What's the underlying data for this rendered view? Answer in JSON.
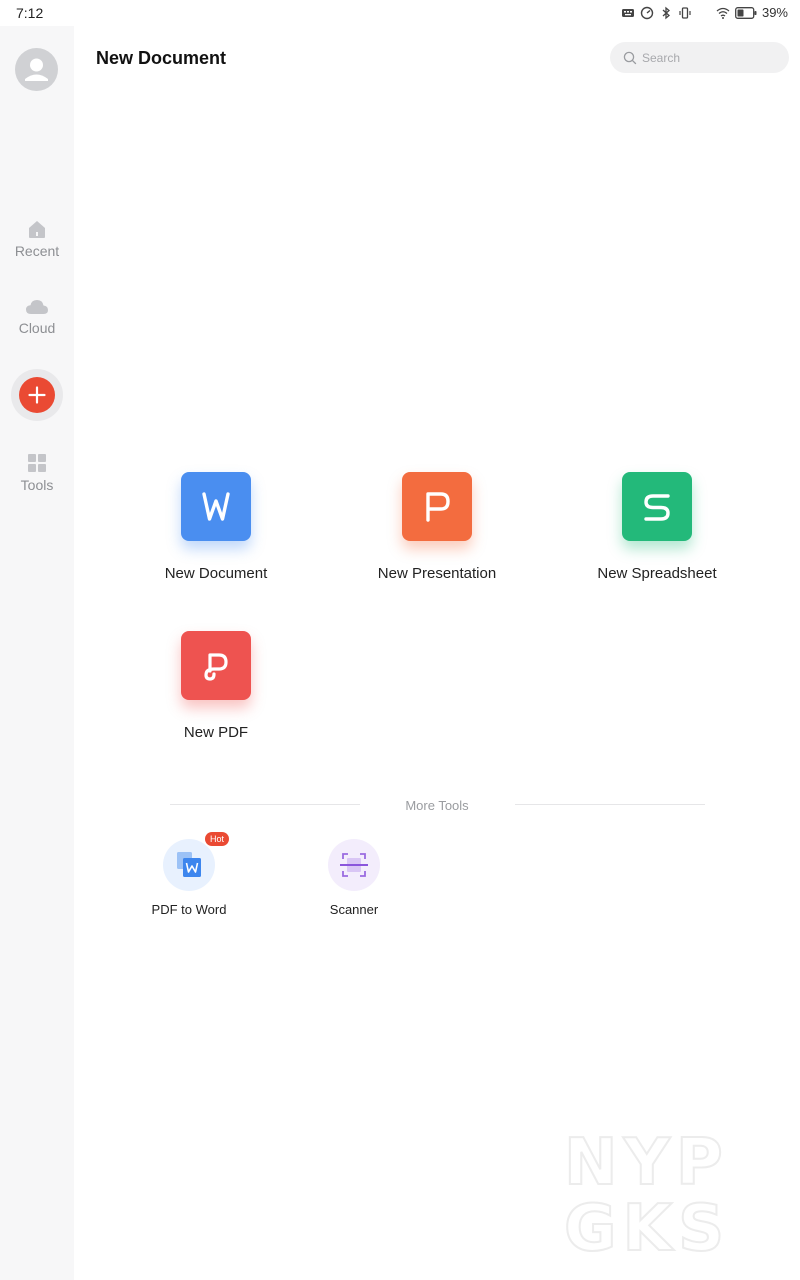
{
  "status_bar": {
    "time": "7:12",
    "battery_text": "39%",
    "icons": [
      "keyboard-icon",
      "speedometer-icon",
      "bluetooth-icon",
      "vibrate-icon",
      "moon-icon",
      "wifi-icon",
      "battery-icon"
    ]
  },
  "sidebar": {
    "items": [
      {
        "label": "Recent",
        "icon": "home-icon"
      },
      {
        "label": "Cloud",
        "icon": "cloud-icon"
      },
      {
        "label": "Tools",
        "icon": "grid-icon"
      }
    ],
    "fab_icon": "plus-icon"
  },
  "header": {
    "title": "New Document",
    "search_placeholder": "Search"
  },
  "create": {
    "items": [
      {
        "label": "New Document",
        "letter": "W",
        "color": "#4a8ef0"
      },
      {
        "label": "New Presentation",
        "letter": "P",
        "color": "#f36c3f"
      },
      {
        "label": "New Spreadsheet",
        "letter": "S",
        "color": "#23b97a"
      },
      {
        "label": "New PDF",
        "letter": "P",
        "color": "#ee5350"
      }
    ]
  },
  "more_tools": {
    "label": "More Tools",
    "items": [
      {
        "label": "PDF to Word",
        "badge": "Hot",
        "icon": "pdf-to-word-icon"
      },
      {
        "label": "Scanner",
        "icon": "scanner-icon"
      }
    ]
  },
  "colors": {
    "accent_red": "#ea4a33",
    "sidebar_bg": "#f7f7f8",
    "label_gray": "#8d8f93"
  },
  "watermark": "NYP GKS"
}
